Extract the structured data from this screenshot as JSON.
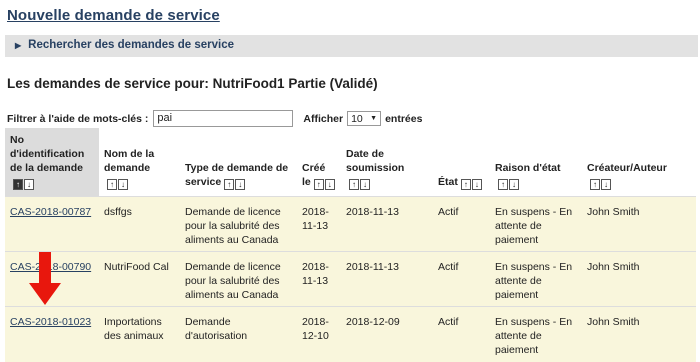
{
  "header": {
    "new_request_link": "Nouvelle demande de service"
  },
  "search_panel": {
    "label": "Rechercher des demandes de service"
  },
  "section": {
    "title": "Les demandes de service pour: NutriFood1 Partie (Validé)"
  },
  "filter": {
    "label": "Filtrer à l'aide de mots-clés :",
    "value": "pai",
    "show_label": "Afficher",
    "page_size": "10",
    "entries_label": "entrées"
  },
  "table": {
    "columns": [
      "No d'identification de la demande",
      "Nom de la demande",
      "Type de demande de service",
      "Créé le",
      "Date de soumission",
      "État",
      "Raison d'état",
      "Créateur/Auteur"
    ],
    "rows": [
      {
        "id": "CAS-2018-00787",
        "name": "dsffgs",
        "type": "Demande de licence pour la salubrité des aliments au Canada",
        "created": "2018-11-13",
        "submitted": "2018-11-13",
        "state": "Actif",
        "reason": "En suspens - En attente de paiement",
        "author": "John Smith"
      },
      {
        "id": "CAS-2018-00790",
        "name": "NutriFood Cal",
        "type": "Demande de licence pour la salubrité des aliments au Canada",
        "created": "2018-11-13",
        "submitted": "2018-11-13",
        "state": "Actif",
        "reason": "En suspens - En attente de paiement",
        "author": "John Smith"
      },
      {
        "id": "CAS-2018-01023",
        "name": "Importations des animaux",
        "type": "Demande d'autorisation",
        "created": "2018-12-10",
        "submitted": "2018-12-09",
        "state": "Actif",
        "reason": "En suspens - En attente de paiement",
        "author": "John Smith"
      }
    ]
  },
  "annotation": {
    "arrow_color": "#e8170d"
  }
}
